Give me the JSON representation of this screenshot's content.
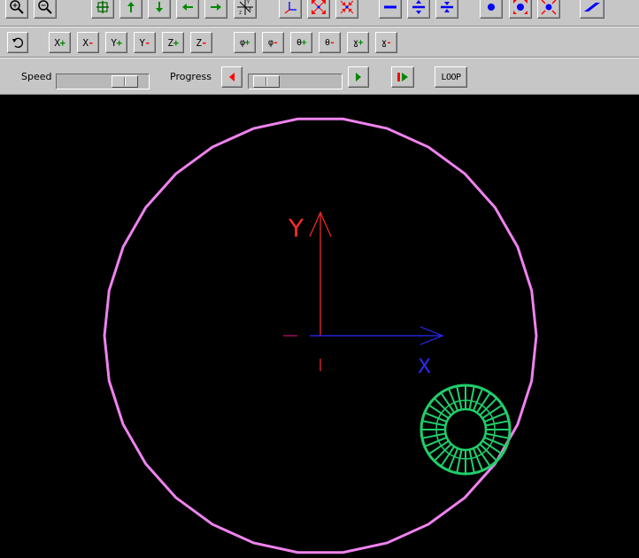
{
  "toolbar_row1": [
    {
      "name": "zoom-in-button",
      "icon": "magnifier-plus-icon"
    },
    {
      "name": "zoom-out-button",
      "icon": "magnifier-minus-icon"
    },
    {
      "name": "center-view-button",
      "icon": "crosshair-grid-icon"
    },
    {
      "name": "pan-up-button",
      "icon": "arrow-up-icon"
    },
    {
      "name": "pan-down-button",
      "icon": "arrow-down-icon"
    },
    {
      "name": "pan-left-button",
      "icon": "arrow-left-icon"
    },
    {
      "name": "pan-right-button",
      "icon": "arrow-right-icon"
    },
    {
      "name": "axes-toggle-button",
      "icon": "xyz-axes-icon"
    },
    {
      "name": "axis-view-button",
      "icon": "axis-corner-icon"
    },
    {
      "name": "expand-view-button",
      "icon": "expand-arrows-icon"
    },
    {
      "name": "contract-view-button",
      "icon": "contract-arrows-icon"
    },
    {
      "name": "line-mode-button",
      "icon": "horizontal-line-icon"
    },
    {
      "name": "line-expand-button",
      "icon": "line-expand-icon"
    },
    {
      "name": "line-contract-button",
      "icon": "line-contract-icon"
    },
    {
      "name": "point-mode-button",
      "icon": "dot-icon"
    },
    {
      "name": "point-expand-button",
      "icon": "dot-expand-icon"
    },
    {
      "name": "point-contract-button",
      "icon": "dot-contract-icon"
    },
    {
      "name": "surface-mode-button",
      "icon": "parallelogram-icon"
    }
  ],
  "toolbar_row2": {
    "reset_icon": "undo-arrow-icon",
    "buttons": [
      {
        "name": "x-plus-button",
        "axis": "X",
        "sign": "+"
      },
      {
        "name": "x-minus-button",
        "axis": "X",
        "sign": "-"
      },
      {
        "name": "y-plus-button",
        "axis": "Y",
        "sign": "+"
      },
      {
        "name": "y-minus-button",
        "axis": "Y",
        "sign": "-"
      },
      {
        "name": "z-plus-button",
        "axis": "Z",
        "sign": "+"
      },
      {
        "name": "z-minus-button",
        "axis": "Z",
        "sign": "-"
      },
      {
        "name": "phi-plus-button",
        "axis": "φ",
        "sign": "+"
      },
      {
        "name": "phi-minus-button",
        "axis": "φ",
        "sign": "-"
      },
      {
        "name": "theta-plus-button",
        "axis": "θ",
        "sign": "+"
      },
      {
        "name": "theta-minus-button",
        "axis": "θ",
        "sign": "-"
      },
      {
        "name": "gamma-plus-button",
        "axis": "ɣ",
        "sign": "+"
      },
      {
        "name": "gamma-minus-button",
        "axis": "ɣ",
        "sign": "-"
      }
    ]
  },
  "toolbar_row3": {
    "speed_label": "Speed",
    "speed_value": 0.85,
    "progress_label": "Progress",
    "progress_value": 0.05,
    "loop_label": "LOOP"
  },
  "viewport": {
    "axis_x_label": "X",
    "axis_y_label": "Y",
    "colors": {
      "background": "#000000",
      "orbit": "#ee82ee",
      "y_axis": "#ff2a2a",
      "x_axis": "#2a2aff",
      "z_axis": "#c01070",
      "torus": "#1fcf6a"
    }
  },
  "colors": {
    "panel": "#c6c6c6",
    "icon_blue": "#0000ff",
    "icon_green": "#008800",
    "icon_red": "#ff0000"
  }
}
